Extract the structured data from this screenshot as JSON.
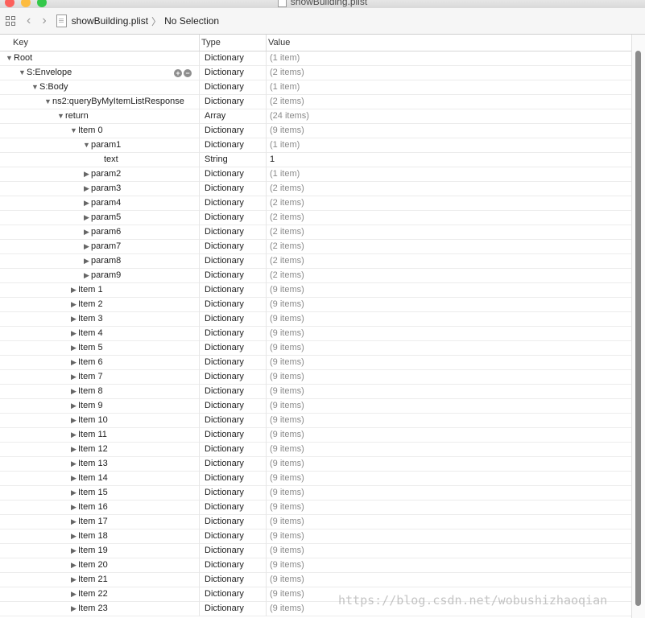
{
  "window": {
    "title": "showBuilding.plist"
  },
  "jumpbar": {
    "file": "showBuilding.plist",
    "selection": "No Selection",
    "back_icon": "chevron-left-icon",
    "forward_icon": "chevron-right-icon"
  },
  "columns": {
    "key": "Key",
    "type": "Type",
    "value": "Value"
  },
  "rows": [
    {
      "name": "row-root",
      "key": "Root",
      "depth": 0,
      "disclosure": "expanded",
      "type": "Dictionary",
      "value": "(1 item)",
      "count": true
    },
    {
      "name": "row-s-envelope",
      "key": "S:Envelope",
      "depth": 1,
      "disclosure": "expanded",
      "type": "Dictionary",
      "value": "(2 items)",
      "count": true,
      "controls": true
    },
    {
      "name": "row-s-body",
      "key": "S:Body",
      "depth": 2,
      "disclosure": "expanded",
      "type": "Dictionary",
      "value": "(1 item)",
      "count": true
    },
    {
      "name": "row-ns2-response",
      "key": "ns2:queryByMyItemListResponse",
      "depth": 3,
      "disclosure": "expanded",
      "type": "Dictionary",
      "value": "(2 items)",
      "count": true
    },
    {
      "name": "row-return",
      "key": "return",
      "depth": 4,
      "disclosure": "expanded",
      "type": "Array",
      "value": "(24 items)",
      "count": true
    },
    {
      "name": "row-item-0",
      "key": "Item 0",
      "depth": 5,
      "disclosure": "expanded",
      "type": "Dictionary",
      "value": "(9 items)",
      "count": true
    },
    {
      "name": "row-param1",
      "key": "param1",
      "depth": 6,
      "disclosure": "expanded",
      "type": "Dictionary",
      "value": "(1 item)",
      "count": true
    },
    {
      "name": "row-text",
      "key": "text",
      "depth": 7,
      "disclosure": "none",
      "type": "String",
      "value": "1",
      "count": false
    },
    {
      "name": "row-param2",
      "key": "param2",
      "depth": 6,
      "disclosure": "collapsed",
      "type": "Dictionary",
      "value": "(1 item)",
      "count": true
    },
    {
      "name": "row-param3",
      "key": "param3",
      "depth": 6,
      "disclosure": "collapsed",
      "type": "Dictionary",
      "value": "(2 items)",
      "count": true
    },
    {
      "name": "row-param4",
      "key": "param4",
      "depth": 6,
      "disclosure": "collapsed",
      "type": "Dictionary",
      "value": "(2 items)",
      "count": true
    },
    {
      "name": "row-param5",
      "key": "param5",
      "depth": 6,
      "disclosure": "collapsed",
      "type": "Dictionary",
      "value": "(2 items)",
      "count": true
    },
    {
      "name": "row-param6",
      "key": "param6",
      "depth": 6,
      "disclosure": "collapsed",
      "type": "Dictionary",
      "value": "(2 items)",
      "count": true
    },
    {
      "name": "row-param7",
      "key": "param7",
      "depth": 6,
      "disclosure": "collapsed",
      "type": "Dictionary",
      "value": "(2 items)",
      "count": true
    },
    {
      "name": "row-param8",
      "key": "param8",
      "depth": 6,
      "disclosure": "collapsed",
      "type": "Dictionary",
      "value": "(2 items)",
      "count": true
    },
    {
      "name": "row-param9",
      "key": "param9",
      "depth": 6,
      "disclosure": "collapsed",
      "type": "Dictionary",
      "value": "(2 items)",
      "count": true
    },
    {
      "name": "row-item-1",
      "key": "Item 1",
      "depth": 5,
      "disclosure": "collapsed",
      "type": "Dictionary",
      "value": "(9 items)",
      "count": true
    },
    {
      "name": "row-item-2",
      "key": "Item 2",
      "depth": 5,
      "disclosure": "collapsed",
      "type": "Dictionary",
      "value": "(9 items)",
      "count": true
    },
    {
      "name": "row-item-3",
      "key": "Item 3",
      "depth": 5,
      "disclosure": "collapsed",
      "type": "Dictionary",
      "value": "(9 items)",
      "count": true
    },
    {
      "name": "row-item-4",
      "key": "Item 4",
      "depth": 5,
      "disclosure": "collapsed",
      "type": "Dictionary",
      "value": "(9 items)",
      "count": true
    },
    {
      "name": "row-item-5",
      "key": "Item 5",
      "depth": 5,
      "disclosure": "collapsed",
      "type": "Dictionary",
      "value": "(9 items)",
      "count": true
    },
    {
      "name": "row-item-6",
      "key": "Item 6",
      "depth": 5,
      "disclosure": "collapsed",
      "type": "Dictionary",
      "value": "(9 items)",
      "count": true
    },
    {
      "name": "row-item-7",
      "key": "Item 7",
      "depth": 5,
      "disclosure": "collapsed",
      "type": "Dictionary",
      "value": "(9 items)",
      "count": true
    },
    {
      "name": "row-item-8",
      "key": "Item 8",
      "depth": 5,
      "disclosure": "collapsed",
      "type": "Dictionary",
      "value": "(9 items)",
      "count": true
    },
    {
      "name": "row-item-9",
      "key": "Item 9",
      "depth": 5,
      "disclosure": "collapsed",
      "type": "Dictionary",
      "value": "(9 items)",
      "count": true
    },
    {
      "name": "row-item-10",
      "key": "Item 10",
      "depth": 5,
      "disclosure": "collapsed",
      "type": "Dictionary",
      "value": "(9 items)",
      "count": true
    },
    {
      "name": "row-item-11",
      "key": "Item 11",
      "depth": 5,
      "disclosure": "collapsed",
      "type": "Dictionary",
      "value": "(9 items)",
      "count": true
    },
    {
      "name": "row-item-12",
      "key": "Item 12",
      "depth": 5,
      "disclosure": "collapsed",
      "type": "Dictionary",
      "value": "(9 items)",
      "count": true
    },
    {
      "name": "row-item-13",
      "key": "Item 13",
      "depth": 5,
      "disclosure": "collapsed",
      "type": "Dictionary",
      "value": "(9 items)",
      "count": true
    },
    {
      "name": "row-item-14",
      "key": "Item 14",
      "depth": 5,
      "disclosure": "collapsed",
      "type": "Dictionary",
      "value": "(9 items)",
      "count": true
    },
    {
      "name": "row-item-15",
      "key": "Item 15",
      "depth": 5,
      "disclosure": "collapsed",
      "type": "Dictionary",
      "value": "(9 items)",
      "count": true
    },
    {
      "name": "row-item-16",
      "key": "Item 16",
      "depth": 5,
      "disclosure": "collapsed",
      "type": "Dictionary",
      "value": "(9 items)",
      "count": true
    },
    {
      "name": "row-item-17",
      "key": "Item 17",
      "depth": 5,
      "disclosure": "collapsed",
      "type": "Dictionary",
      "value": "(9 items)",
      "count": true
    },
    {
      "name": "row-item-18",
      "key": "Item 18",
      "depth": 5,
      "disclosure": "collapsed",
      "type": "Dictionary",
      "value": "(9 items)",
      "count": true
    },
    {
      "name": "row-item-19",
      "key": "Item 19",
      "depth": 5,
      "disclosure": "collapsed",
      "type": "Dictionary",
      "value": "(9 items)",
      "count": true
    },
    {
      "name": "row-item-20",
      "key": "Item 20",
      "depth": 5,
      "disclosure": "collapsed",
      "type": "Dictionary",
      "value": "(9 items)",
      "count": true
    },
    {
      "name": "row-item-21",
      "key": "Item 21",
      "depth": 5,
      "disclosure": "collapsed",
      "type": "Dictionary",
      "value": "(9 items)",
      "count": true
    },
    {
      "name": "row-item-22",
      "key": "Item 22",
      "depth": 5,
      "disclosure": "collapsed",
      "type": "Dictionary",
      "value": "(9 items)",
      "count": true
    },
    {
      "name": "row-item-23",
      "key": "Item 23",
      "depth": 5,
      "disclosure": "collapsed",
      "type": "Dictionary",
      "value": "(9 items)",
      "count": true
    }
  ],
  "watermark": "https://blog.csdn.net/wobushizhaoqian",
  "colors": {
    "close": "#fc605b",
    "minimize": "#fdbc40",
    "zoom": "#34c84a",
    "count_text": "#8a8a8a"
  }
}
